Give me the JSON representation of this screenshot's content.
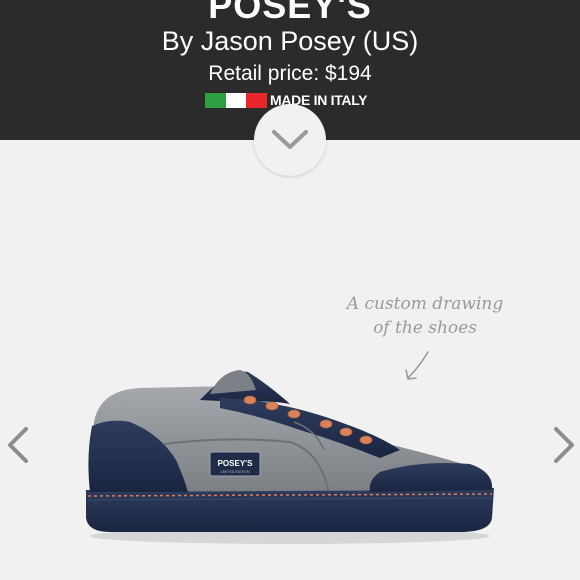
{
  "header": {
    "title": "POSEY'S",
    "designer": "By Jason Posey (US)",
    "price": "Retail price: $194",
    "made_in": "MADE IN ITALY",
    "flag_colors": [
      "#2ea043",
      "#ffffff",
      "#e8262b"
    ]
  },
  "scroll_button": {
    "icon": "chevron-down-icon"
  },
  "annotation": {
    "line1": "A custom drawing",
    "line2": "of the shoes"
  },
  "shoe": {
    "tag_text": "POSEY'S",
    "tag_subtext": "LIMITED EDITION",
    "colors": {
      "upper": "#8f9296",
      "navy": "#23314f",
      "sole": "#1c2640",
      "laces": "#d9825b",
      "stitch": "#e07a55"
    }
  },
  "carousel": {
    "prev_icon": "chevron-left-icon",
    "next_icon": "chevron-right-icon"
  }
}
